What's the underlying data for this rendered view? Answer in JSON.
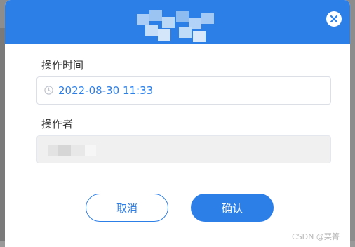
{
  "dialog": {
    "title": "",
    "close_icon": "close-icon"
  },
  "form": {
    "time_label": "操作时间",
    "time_value": "2022-08-30 11:33",
    "time_icon": "clock-icon",
    "operator_label": "操作者",
    "operator_value": ""
  },
  "buttons": {
    "cancel_label": "取消",
    "confirm_label": "确认"
  },
  "watermark": "CSDN @琹箐",
  "colors": {
    "primary": "#2d7fe8",
    "input_disabled_bg": "#f0f0f0",
    "overlay": "#8d8d8d"
  }
}
